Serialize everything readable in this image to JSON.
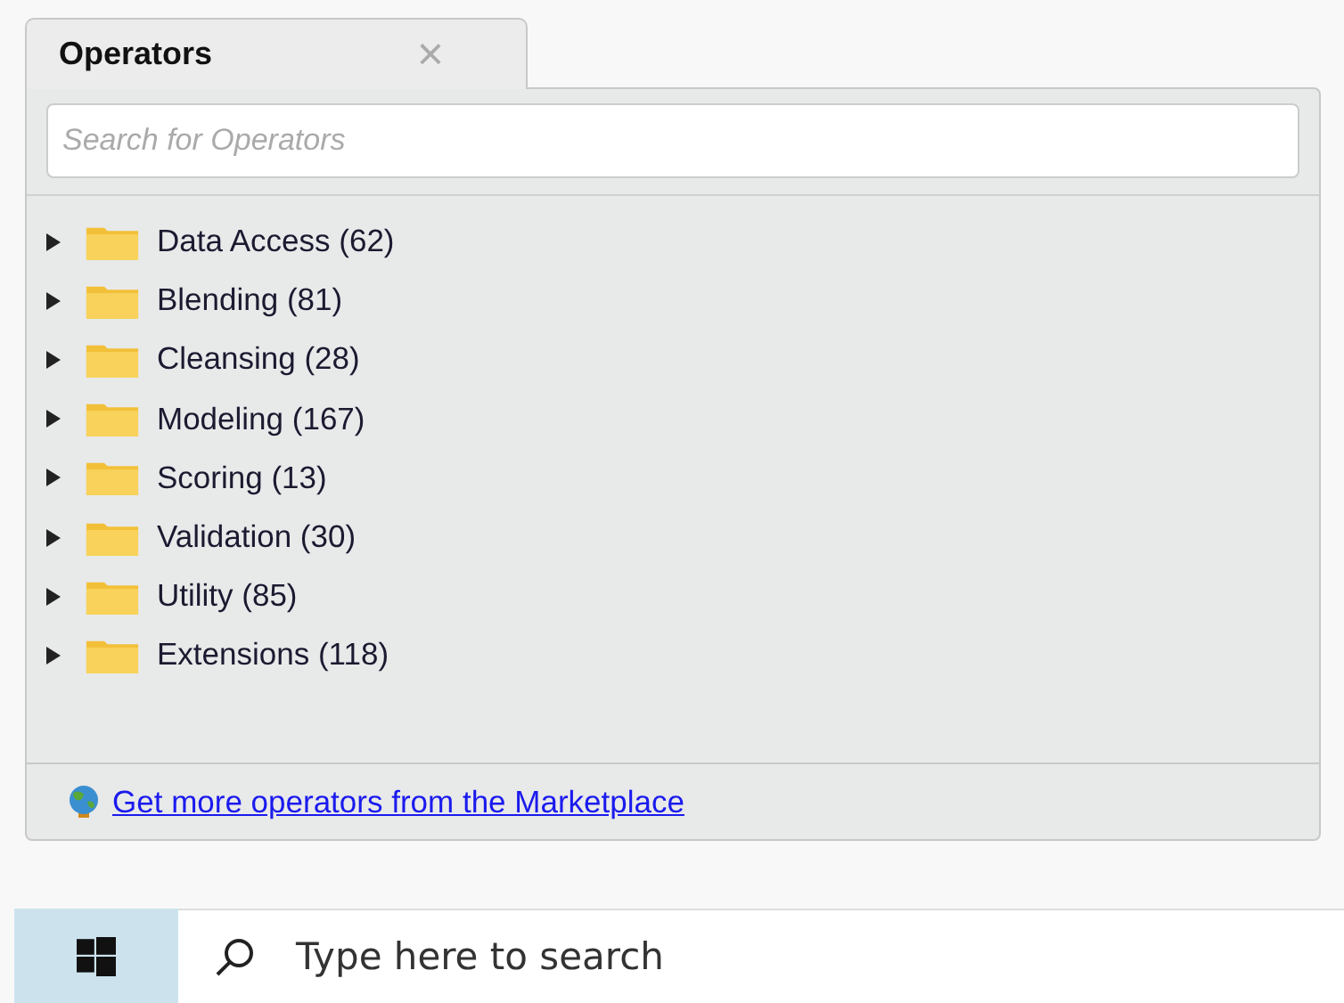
{
  "tab": {
    "title": "Operators",
    "close": "×"
  },
  "search": {
    "placeholder": "Search for Operators"
  },
  "tree": [
    {
      "label": "Data Access (62)",
      "expanded": false
    },
    {
      "label": "Blending (81)",
      "expanded": false
    },
    {
      "label": "Cleansing (28)",
      "expanded": false
    },
    {
      "label": "Modeling (167)",
      "expanded": false
    },
    {
      "label": "Scoring (13)",
      "expanded": false
    },
    {
      "label": "Validation (30)",
      "expanded": false
    },
    {
      "label": "Utility (85)",
      "expanded": false
    },
    {
      "label": "Extensions (118)",
      "expanded": false
    }
  ],
  "footer_link": "Get more operators from the Marketplace",
  "taskbar": {
    "search_placeholder": "Type here to search"
  }
}
